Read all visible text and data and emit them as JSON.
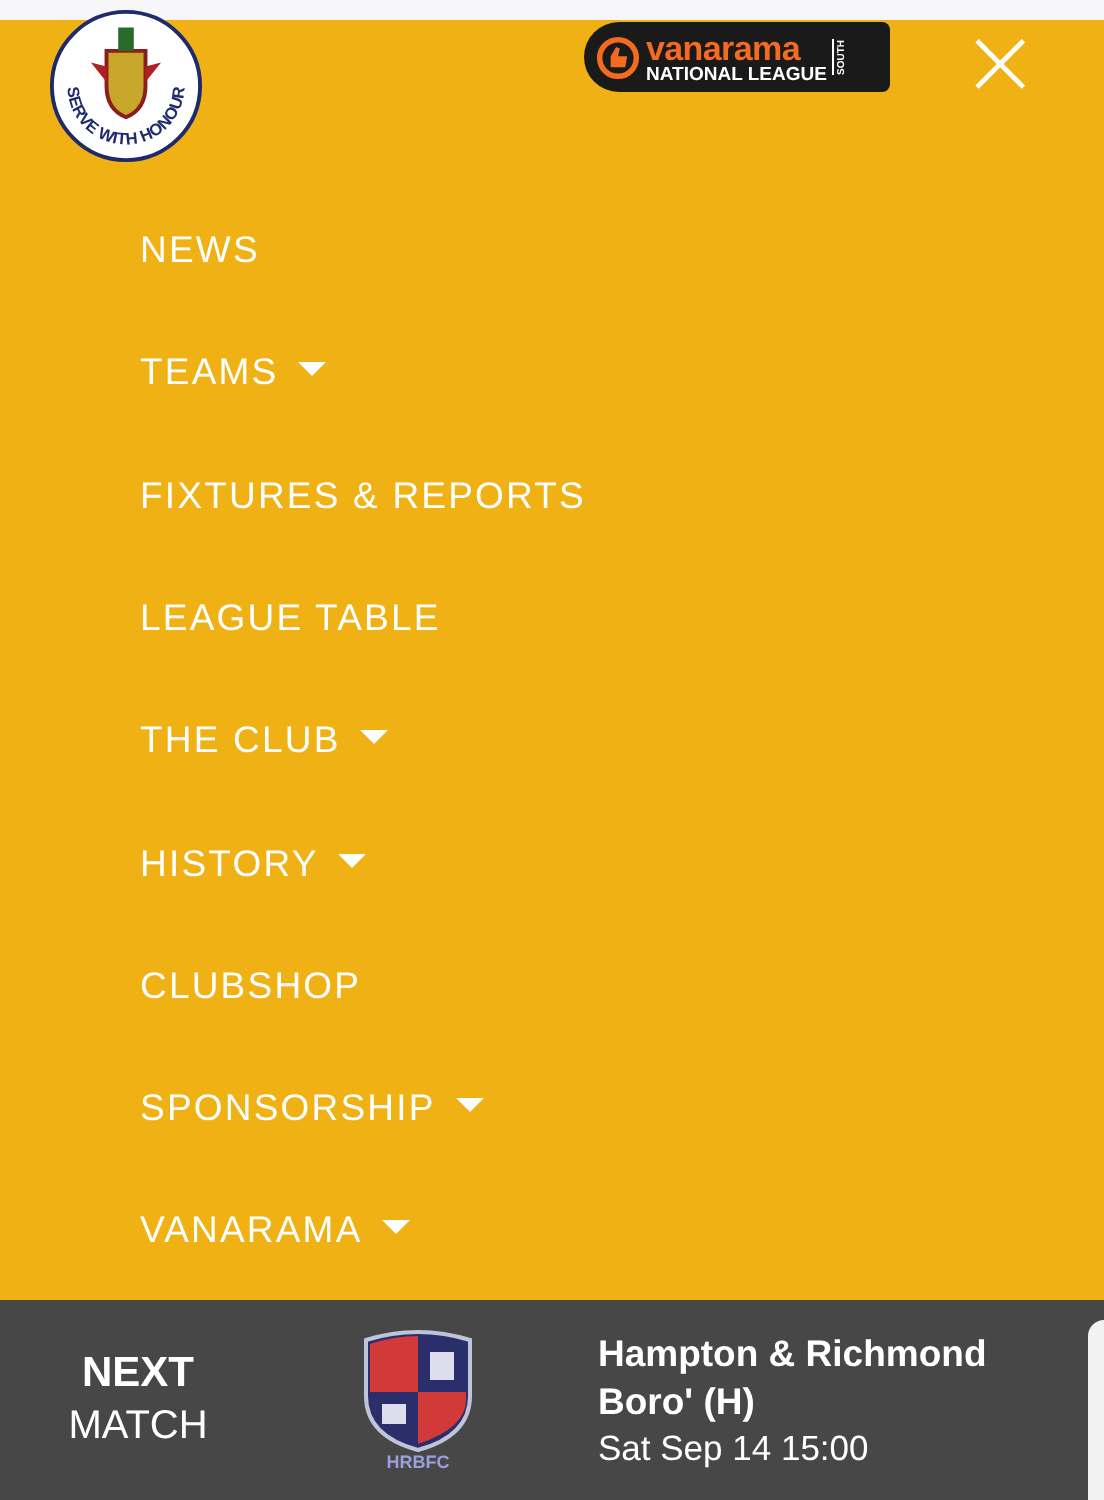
{
  "header": {
    "crest_motto": "SERVE WITH HONOUR",
    "league_logo": {
      "brand": "vanarama",
      "league": "NATIONAL LEAGUE",
      "region": "SOUTH"
    },
    "close": "×"
  },
  "menu": [
    {
      "label": "NEWS",
      "has_submenu": false
    },
    {
      "label": "TEAMS",
      "has_submenu": true
    },
    {
      "label": "FIXTURES & REPORTS",
      "has_submenu": false
    },
    {
      "label": "LEAGUE TABLE",
      "has_submenu": false
    },
    {
      "label": "THE CLUB",
      "has_submenu": true
    },
    {
      "label": "HISTORY",
      "has_submenu": true
    },
    {
      "label": "CLUBSHOP",
      "has_submenu": false
    },
    {
      "label": "SPONSORSHIP",
      "has_submenu": true
    },
    {
      "label": "VANARAMA",
      "has_submenu": true
    }
  ],
  "next_match": {
    "heading": "NEXT",
    "subheading": "MATCH",
    "crest_caption": "HRBFC",
    "opponent": "Hampton & Richmond Boro' (H)",
    "datetime": "Sat Sep 14 15:00"
  }
}
